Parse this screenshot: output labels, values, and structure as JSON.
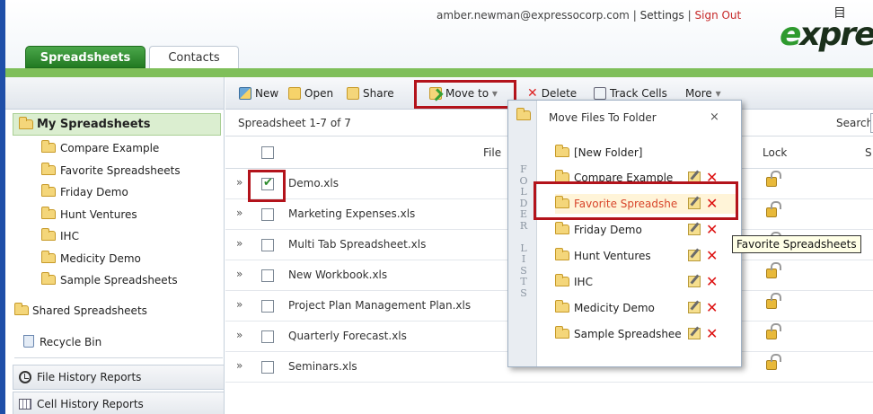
{
  "header": {
    "user_email": "amber.newman@expressocorp.com",
    "separator": "|",
    "settings_label": "Settings",
    "signout_label": "Sign Out",
    "logo_text": "expres",
    "logo_glyph": "目"
  },
  "tabs": [
    {
      "label": "Spreadsheets",
      "active": true
    },
    {
      "label": "Contacts",
      "active": false
    }
  ],
  "sidebar": {
    "my_spreadsheets_label": "My Spreadsheets",
    "folders": [
      "Compare Example",
      "Favorite Spreadsheets",
      "Friday Demo",
      "Hunt Ventures",
      "IHC",
      "Medicity Demo",
      "Sample Spreadsheets"
    ],
    "shared_label": "Shared Spreadsheets",
    "recycle_label": "Recycle Bin",
    "file_history_label": "File History Reports",
    "cell_history_label": "Cell History Reports"
  },
  "toolbar": {
    "new_label": "New",
    "open_label": "Open",
    "share_label": "Share",
    "move_label": "Move to",
    "move_arrow": "▾",
    "delete_label": "Delete",
    "track_label": "Track Cells",
    "more_label": "More"
  },
  "list": {
    "count_text": "Spreadsheet 1-7 of 7",
    "search_label": "Search:",
    "col_file": "File",
    "col_lock": "Lock",
    "col_s": "S",
    "files": [
      {
        "name": "Demo.xls",
        "checked": true
      },
      {
        "name": "Marketing Expenses.xls",
        "checked": false
      },
      {
        "name": "Multi Tab Spreadsheet.xls",
        "checked": false
      },
      {
        "name": "New Workbook.xls",
        "checked": false
      },
      {
        "name": "Project Plan Management Plan.xls",
        "checked": false
      },
      {
        "name": "Quarterly Forecast.xls",
        "checked": false
      },
      {
        "name": "Seminars.xls",
        "checked": false
      }
    ],
    "expand_glyph": "»"
  },
  "move_dropdown": {
    "title": "Move Files To Folder",
    "close_glyph": "×",
    "side_letters": [
      "F",
      "O",
      "L",
      "D",
      "E",
      "R",
      "",
      "L",
      "I",
      "S",
      "T",
      "S"
    ],
    "new_folder_label": "[New Folder]",
    "folders": [
      "Compare Example",
      "Favorite Spreadshe",
      "Friday Demo",
      "Hunt Ventures",
      "IHC",
      "Medicity Demo",
      "Sample Spreadshee"
    ],
    "highlighted_index": 1,
    "delete_glyph": "✕"
  },
  "tooltip": "Favorite Spreadsheets",
  "colors": {
    "accent_green": "#2e8b2e",
    "highlight_red": "#b3131b",
    "signout": "#c62828"
  }
}
